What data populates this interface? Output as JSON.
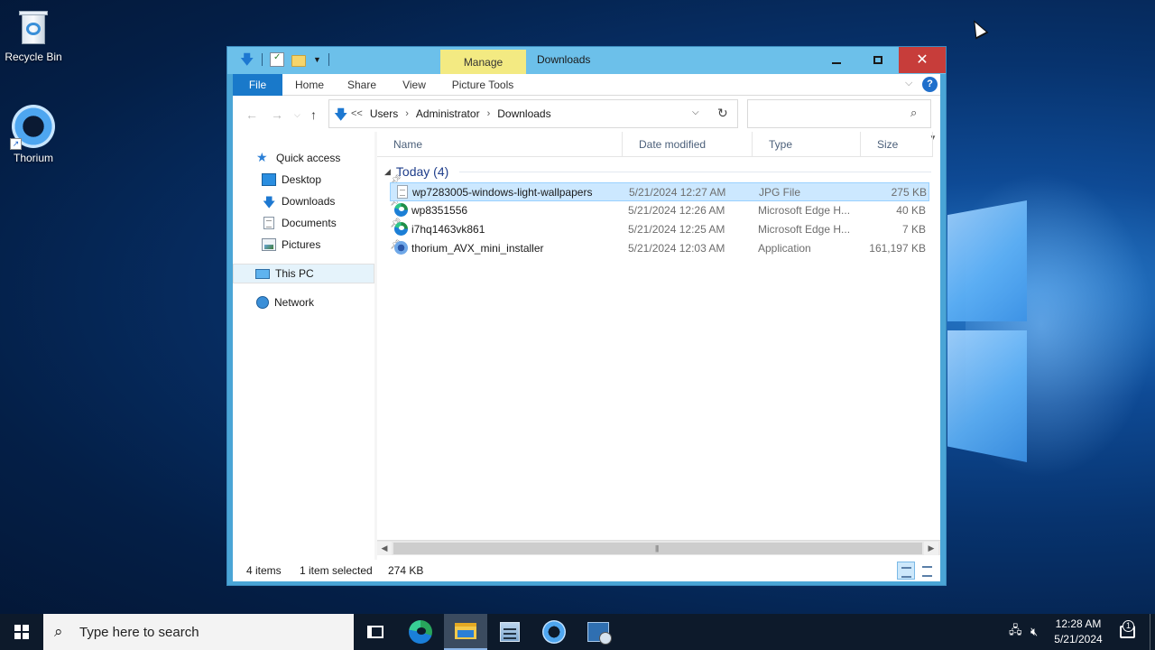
{
  "desktop": {
    "icons": [
      {
        "label": "Recycle Bin",
        "icon": "recycle-bin-icon"
      },
      {
        "label": "Thorium",
        "icon": "thorium-browser-icon"
      }
    ]
  },
  "window": {
    "title": "Downloads",
    "manage_tab": "Manage",
    "colors": {
      "titlebar": "#6cc0ea",
      "close": "#c73d3a",
      "file_tab": "#1979ca",
      "manage": "#f3ea82",
      "selection": "#cce8ff"
    }
  },
  "ribbon": {
    "tabs": [
      "File",
      "Home",
      "Share",
      "View",
      "Picture Tools"
    ],
    "help": "?"
  },
  "address": {
    "prefix": "<<",
    "crumbs": [
      "Users",
      "Administrator",
      "Downloads"
    ],
    "search_placeholder": ""
  },
  "nav": {
    "quick_access": "Quick access",
    "items": [
      {
        "label": "Desktop",
        "icon": "desktop-icon",
        "pinned": true
      },
      {
        "label": "Downloads",
        "icon": "downloads-icon",
        "pinned": true
      },
      {
        "label": "Documents",
        "icon": "documents-icon",
        "pinned": true
      },
      {
        "label": "Pictures",
        "icon": "pictures-icon",
        "pinned": true
      }
    ],
    "this_pc": "This PC",
    "network": "Network"
  },
  "files": {
    "columns": [
      "Name",
      "Date modified",
      "Type",
      "Size"
    ],
    "group": "Today (4)",
    "rows": [
      {
        "name": "wp7283005-windows-light-wallpapers",
        "date": "5/21/2024 12:27 AM",
        "type": "JPG File",
        "size": "275 KB",
        "icon": "jpg-file-icon",
        "selected": true
      },
      {
        "name": "wp8351556",
        "date": "5/21/2024 12:26 AM",
        "type": "Microsoft Edge H...",
        "size": "40 KB",
        "icon": "edge-html-icon",
        "selected": false
      },
      {
        "name": "i7hq1463vk861",
        "date": "5/21/2024 12:25 AM",
        "type": "Microsoft Edge H...",
        "size": "7 KB",
        "icon": "edge-html-icon",
        "selected": false
      },
      {
        "name": "thorium_AVX_mini_installer",
        "date": "5/21/2024 12:03 AM",
        "type": "Application",
        "size": "161,197 KB",
        "icon": "installer-icon",
        "selected": false
      }
    ]
  },
  "status": {
    "count": "4 items",
    "selected": "1 item selected",
    "size": "274 KB"
  },
  "taskbar": {
    "search_placeholder": "Type here to search",
    "apps": [
      "task-view-icon",
      "edge-icon",
      "file-explorer-icon",
      "server-manager-icon",
      "thorium-icon",
      "network-app-icon"
    ],
    "time": "12:28 AM",
    "date": "5/21/2024",
    "notifications": "1"
  }
}
